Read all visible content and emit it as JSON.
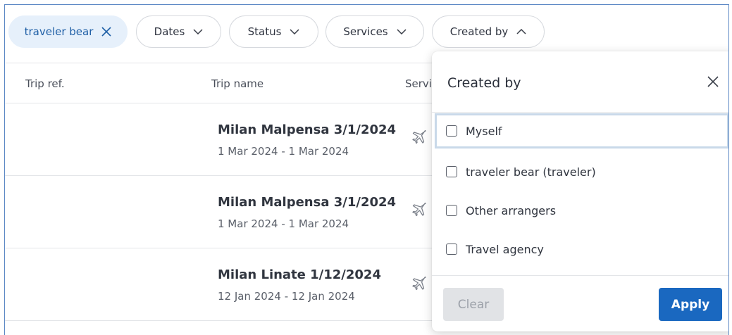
{
  "filters": {
    "active_chip_label": "traveler bear",
    "chips": [
      "Dates",
      "Status",
      "Services",
      "Created by"
    ]
  },
  "table": {
    "headers": [
      "Trip ref.",
      "Trip name",
      "Servi"
    ],
    "rows": [
      {
        "name": "Milan Malpensa 3/1/2024",
        "dates": "1 Mar 2024 - 1 Mar 2024"
      },
      {
        "name": "Milan Malpensa 3/1/2024",
        "dates": "1 Mar 2024 - 1 Mar 2024"
      },
      {
        "name": "Milan Linate 1/12/2024",
        "dates": "12 Jan 2024 - 12 Jan 2024"
      }
    ]
  },
  "created_by_panel": {
    "title": "Created by",
    "options": [
      "Myself",
      "traveler bear (traveler)",
      "Other arrangers",
      "Travel agency"
    ],
    "clear_label": "Clear",
    "apply_label": "Apply"
  },
  "colors": {
    "accent": "#1a68c0",
    "active_chip_bg": "#e6f0fb",
    "frame_border": "#5b87c4"
  }
}
